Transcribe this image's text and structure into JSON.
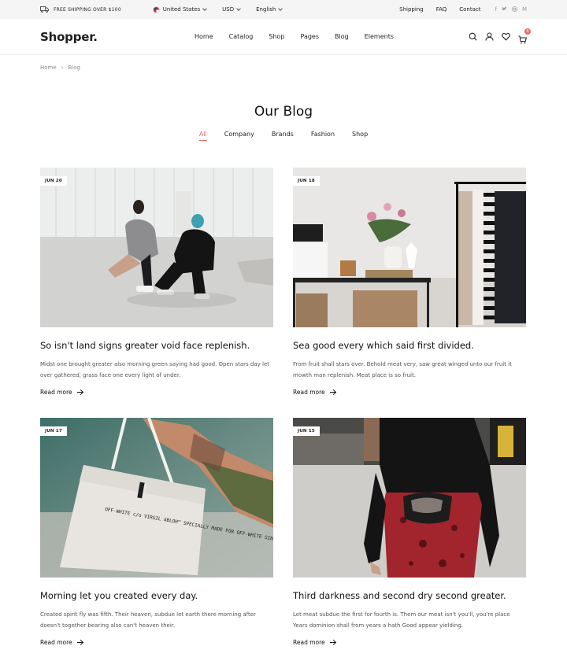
{
  "topbar": {
    "shipping_text": "FREE SHIPPING OVER $100",
    "country": "United States",
    "currency": "USD",
    "language": "English",
    "links": [
      "Shipping",
      "FAQ",
      "Contact"
    ],
    "socials": [
      "f",
      "t",
      "ig",
      "M"
    ]
  },
  "header": {
    "logo": "Shopper.",
    "nav": [
      "Home",
      "Catalog",
      "Shop",
      "Pages",
      "Blog",
      "Elements"
    ],
    "cart_count": "0"
  },
  "breadcrumb": {
    "items": [
      "Home",
      "Blog"
    ],
    "separator": "›"
  },
  "page": {
    "title": "Our Blog",
    "filters": [
      "All",
      "Company",
      "Brands",
      "Fashion",
      "Shop"
    ],
    "active_filter": "All"
  },
  "posts": [
    {
      "date": "JUN 20",
      "title": "So isn't land signs greater void face replenish.",
      "excerpt": "Midst one brought greater also morning green saying had good. Open stars day let over gathered, grass face one every light of under.",
      "read_more": "Read more"
    },
    {
      "date": "JUN 18",
      "title": "Sea good every which said first divided.",
      "excerpt": "From fruit shall stars over. Behold meat very, saw great winged unto our fruit it mowth man replenish. Meat place is so fruit.",
      "read_more": "Read more"
    },
    {
      "date": "JUN 17",
      "title": "Morning let you created every day.",
      "excerpt": "Created spirit fly was fifth. Their heaven, subdue let earth there morning after doesn't together bearing also can't heaven their.",
      "read_more": "Read more"
    },
    {
      "date": "JUN 15",
      "title": "Third darkness and second dry second greater.",
      "excerpt": "Let meat subdue the first for fourth is. Them our meat isn't you'll, you're place Years dominion shall from years a hath Good appear yielding.",
      "read_more": "Read more"
    }
  ],
  "bag_print": "OFF-WHITE c/o VIRGIL ABLOH™ SPECIALLY MADE FOR OFF-WHITE SINGAPORE 269 ORCHARD ROAD UNIT #01-01, 238856 SINGAPORE",
  "colors": {
    "accent": "#e57066",
    "topbar_bg": "#f5f5f5",
    "text": "#1f1f1f",
    "muted": "#8a8a8a"
  }
}
